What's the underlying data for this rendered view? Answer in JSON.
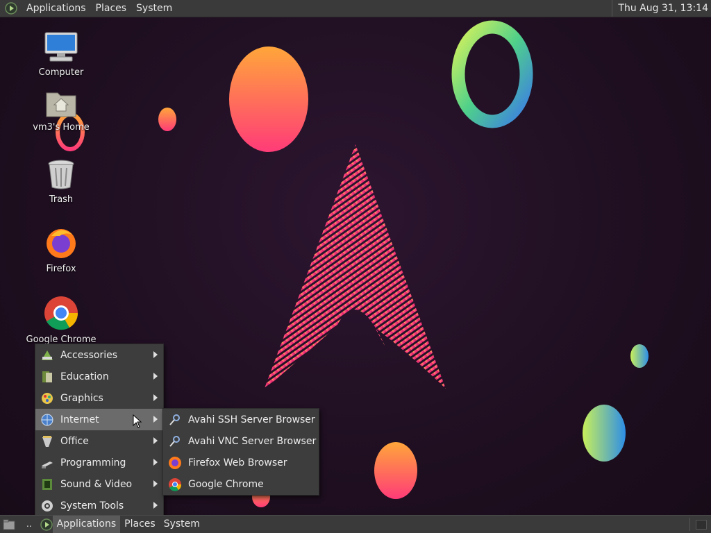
{
  "top_panel": {
    "menus": [
      "Applications",
      "Places",
      "System"
    ],
    "clock": "Thu Aug 31, 13:14"
  },
  "desktop_icons": [
    {
      "label": "Computer",
      "icon": "computer-icon"
    },
    {
      "label": "vm3's Home",
      "icon": "home-folder-icon"
    },
    {
      "label": "Trash",
      "icon": "trash-icon"
    },
    {
      "label": "Firefox",
      "icon": "firefox-icon"
    },
    {
      "label": "Google Chrome",
      "icon": "chrome-icon"
    }
  ],
  "apps_menu": {
    "items": [
      {
        "label": "Accessories",
        "icon": "accessories-icon"
      },
      {
        "label": "Education",
        "icon": "education-icon"
      },
      {
        "label": "Graphics",
        "icon": "graphics-icon"
      },
      {
        "label": "Internet",
        "icon": "internet-icon",
        "highlighted": true
      },
      {
        "label": "Office",
        "icon": "office-icon"
      },
      {
        "label": "Programming",
        "icon": "programming-icon"
      },
      {
        "label": "Sound & Video",
        "icon": "sound-video-icon"
      },
      {
        "label": "System Tools",
        "icon": "system-tools-icon"
      }
    ]
  },
  "internet_submenu": {
    "items": [
      {
        "label": "Avahi SSH Server Browser",
        "icon": "avahi-icon"
      },
      {
        "label": "Avahi VNC Server Browser",
        "icon": "avahi-icon"
      },
      {
        "label": "Firefox Web Browser",
        "icon": "firefox-icon"
      },
      {
        "label": "Google Chrome",
        "icon": "chrome-icon"
      }
    ]
  },
  "bottom_panel": {
    "show_desktop_icon": "show-desktop-icon",
    "ellipsis": "..",
    "menus": [
      "Applications",
      "Places",
      "System"
    ]
  }
}
